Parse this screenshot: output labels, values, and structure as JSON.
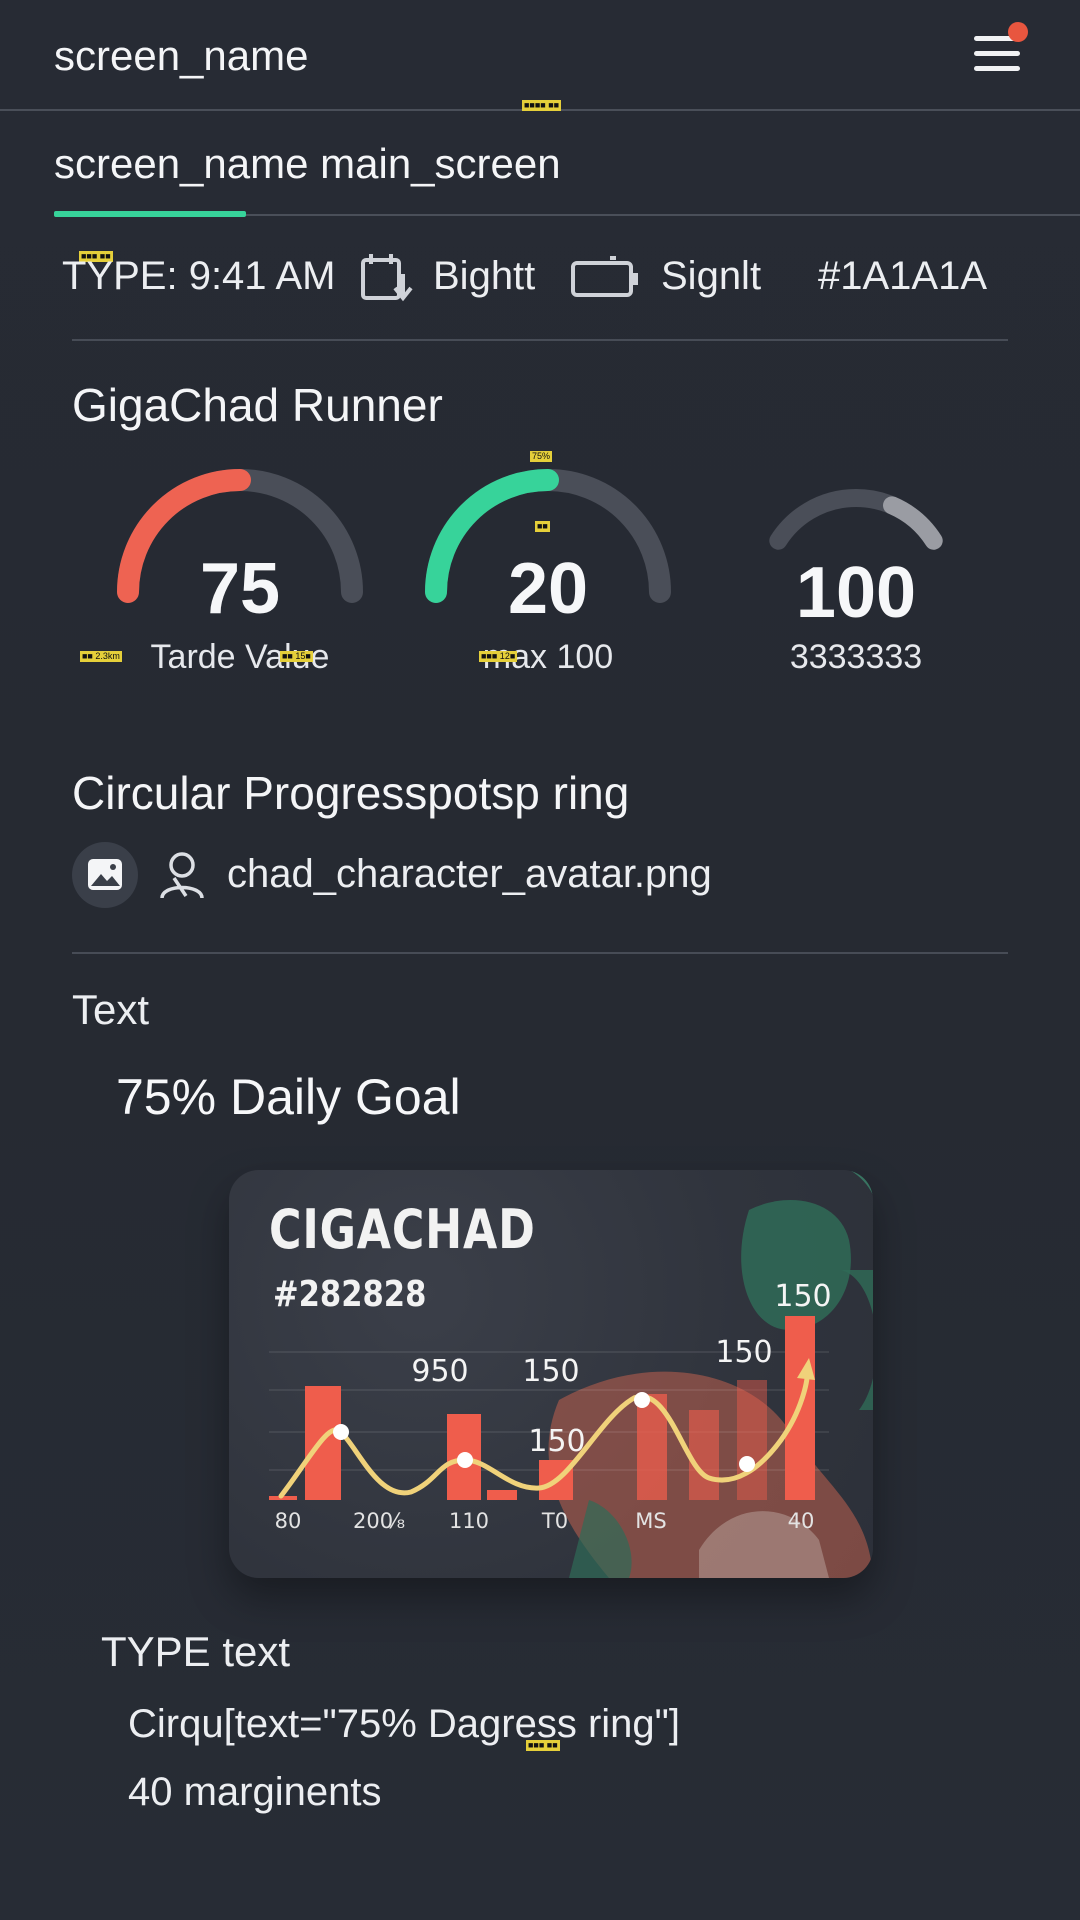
{
  "app_bar": {
    "title": "screen_name"
  },
  "tabs": [
    {
      "label": "screen_name main_screen",
      "active": true
    }
  ],
  "status": {
    "time": "TYPE: 9:41 AM",
    "signal_a": "Bightt",
    "signal_b": "Signlt",
    "color_code": "#1A1A1A"
  },
  "notes": {
    "header_tag": "■■■■ ■■",
    "status_tag": "■■■ ■■",
    "gauge_pct": "75%",
    "gauge_mid": "■■",
    "dist": "■■ 2.3km",
    "time_a": "■■ 15■",
    "time_b": "■■■ 12■",
    "bottom_tag": "■■■ ■■"
  },
  "runner": {
    "title": "GigaChad Runner",
    "gauges": [
      {
        "value": "75",
        "caption": "Tarde Value",
        "progress": 0.5,
        "color": "#ee6352"
      },
      {
        "value": "20",
        "caption": "max 100",
        "progress": 0.5,
        "color": "#37d39a"
      },
      {
        "value": "100",
        "caption": "3333333",
        "progress": 0.3,
        "color": "#9a9ca3"
      }
    ]
  },
  "progress_section": {
    "title": "Circular Progresspotsp ring",
    "file_name": "chad_character_avatar.png",
    "icons": [
      "image-icon",
      "person-icon"
    ]
  },
  "text_section": {
    "label": "Text",
    "goal": "75% Daily Goal"
  },
  "card": {
    "brand": "CIGACHAD",
    "hex": "#282828",
    "annotations": [
      "950",
      "150",
      "150",
      "150",
      "150"
    ],
    "x_labels": [
      "80",
      "200⁄₈",
      "110",
      "T0",
      "MS",
      "40"
    ]
  },
  "type_section": {
    "label": "TYPE text",
    "lines": [
      "Cirqu[text=\"75% Dagress ring\"]",
      "40 marginents"
    ]
  },
  "colors": {
    "accent": "#37d39a",
    "alert": "#e8563f",
    "background": "#262a33"
  }
}
